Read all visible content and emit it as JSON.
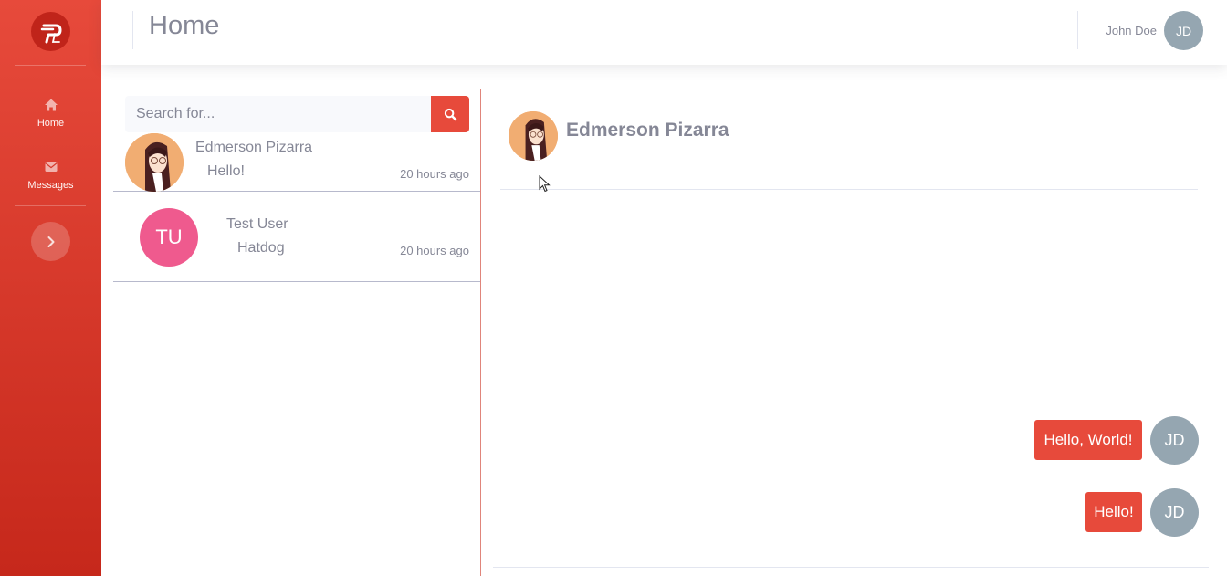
{
  "sidebar": {
    "items": [
      {
        "label": "Home",
        "icon": "home-icon"
      },
      {
        "label": "Messages",
        "icon": "envelope-icon"
      }
    ],
    "toggle_icon": "chevron-right-icon",
    "accent": "#e74a3b"
  },
  "header": {
    "title": "Home",
    "user_name": "John Doe",
    "user_initials": "JD"
  },
  "search": {
    "placeholder": "Search for..."
  },
  "contacts": [
    {
      "name": "Edmerson Pizarra",
      "last_message": "Hello!",
      "time": "20 hours ago",
      "avatar": "photo"
    },
    {
      "name": "Test User",
      "initials": "TU",
      "last_message": "Hatdog",
      "time": "20 hours ago",
      "avatar_color": "#ef5a8e"
    }
  ],
  "chat": {
    "contact_name": "Edmerson Pizarra",
    "messages": [
      {
        "text": "Hello, World!",
        "sender_initials": "JD"
      },
      {
        "text": "Hello!",
        "sender_initials": "JD"
      }
    ]
  }
}
